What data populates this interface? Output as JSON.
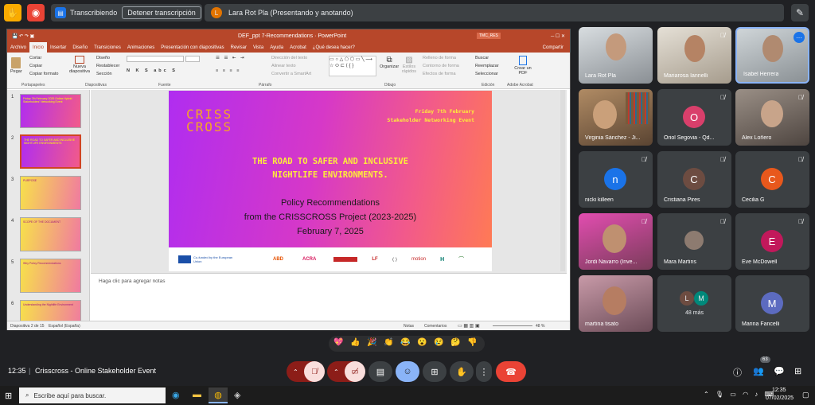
{
  "top": {
    "transcribing": "Transcribiendo",
    "stop_transcription": "Detener transcripción",
    "presenter_initial": "L",
    "presenter": "Lara Rot Pla (Presentando y anotando)"
  },
  "ppt": {
    "title": "DEF_ppt 7-Recommendations  ·  PowerPoint",
    "badge": "TMC_RES",
    "tabs": [
      "Archivo",
      "Inicio",
      "Insertar",
      "Diseño",
      "Transiciones",
      "Animaciones",
      "Presentación con diapositivas",
      "Revisar",
      "Vista",
      "Ayuda",
      "Acrobat",
      "¿Qué desea hacer?"
    ],
    "share": "Compartir",
    "ribbon": {
      "paste": "Pegar",
      "cut": "Cortar",
      "copy": "Copiar",
      "copy_format": "Copiar formato",
      "clipboard": "Portapapeles",
      "new_slide": "Nueva diapositiva",
      "design": "Diseño",
      "reset": "Restablecer",
      "section": "Sección",
      "slides": "Diapositivas",
      "font": "Fuente",
      "paragraph": "Párrafo",
      "text_dir": "Dirección del texto",
      "align_text": "Alinear texto",
      "convert_smartart": "Convertir a SmartArt",
      "organize": "Organizar",
      "quick_styles": "Estilos rápidos",
      "shape_fill": "Relleno de forma",
      "shape_outline": "Contorno de forma",
      "shape_effects": "Efectos de forma",
      "drawing": "Dibujo",
      "find": "Buscar",
      "replace": "Reemplazar",
      "select": "Seleccionar",
      "editing": "Edición",
      "create_pdf": "Crear un PDF",
      "acrobat": "Adobe Acrobat"
    },
    "thumb_titles": [
      "Friday 7th February 2025 Online Hybrid Stakeholders' Networking Event",
      "THE ROAD TO SAFER AND INCLUSIVE NIGHTLIFE ENVIRONMENTS",
      "PURPOSE",
      "SCOPE OF THE DOCUMENT",
      "Why Policy Recommendations",
      "Understanding the Nightlife Environment"
    ],
    "thumb_nums": [
      "1",
      "2",
      "3",
      "4",
      "5",
      "6"
    ],
    "slide": {
      "logo1": "CRISS",
      "logo2": "CROSS",
      "date": "Friday 7th February",
      "event": "Stakeholder Networking Event",
      "headline1": "THE ROAD  TO SAFER AND INCLUSIVE",
      "headline2": "NIGHTLIFE  ENVIRONMENTS.",
      "sub1": "Policy Recommendations",
      "sub2": "from the CRISSCROSS Project (2023-2025)",
      "sub3": "February 7, 2025"
    },
    "logos": {
      "eu": "Co-funded by the European Union",
      "abd": "ABD",
      "acra": "ACRA",
      "motion": "motion"
    },
    "notes_placeholder": "Haga clic para agregar notas",
    "status": {
      "slide": "Diapositiva 2 de 15",
      "lang": "Español (España)",
      "notes": "Notas",
      "comments": "Comentarios",
      "zoom": "48 %"
    }
  },
  "participants": [
    {
      "name": "Lara Rot Pla",
      "type": "video"
    },
    {
      "name": "Mariarosa Iannelli",
      "type": "video"
    },
    {
      "name": "Isabel Herrera",
      "type": "video"
    },
    {
      "name": "Virginia Sánchez - Ji...",
      "type": "video"
    },
    {
      "name": "Oriol Segovia - Qd...",
      "initial": "O",
      "color": "#d93f6b"
    },
    {
      "name": "Alex Loñero",
      "type": "video"
    },
    {
      "name": "nicki killeen",
      "initial": "n",
      "color": "#1a73e8"
    },
    {
      "name": "Cristiana Pires",
      "initial": "C",
      "color": "#6d4c41"
    },
    {
      "name": "Cecilia G",
      "initial": "C",
      "color": "#e8581c"
    },
    {
      "name": "Jordi Navarro (Inve...",
      "type": "video"
    },
    {
      "name": "Mara Martins",
      "type": "video"
    },
    {
      "name": "Eve McDowell",
      "initial": "E",
      "color": "#c2185b"
    },
    {
      "name": "martina tisato",
      "type": "video"
    },
    {
      "name": "48 más",
      "initial": "L",
      "initial2": "M"
    },
    {
      "name": "Marina Fancelli",
      "initial": "M",
      "color": "#5c6bc0"
    }
  ],
  "bottom": {
    "time": "12:35",
    "meeting": "Crisscross - Online Stakeholder Event",
    "people_count": "63"
  },
  "emojis": [
    "💖",
    "👍",
    "🎉",
    "👏",
    "😂",
    "😮",
    "😢",
    "🤔",
    "👎"
  ],
  "taskbar": {
    "search": "Escribe aquí para buscar.",
    "time": "12:35",
    "date": "07/02/2025"
  }
}
